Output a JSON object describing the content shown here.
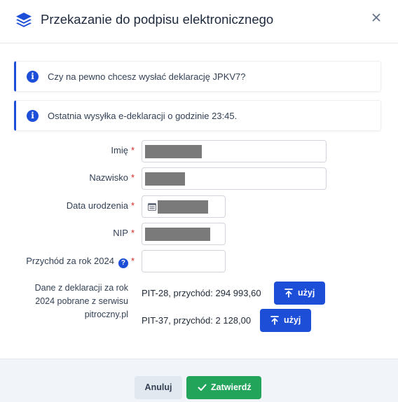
{
  "dialog": {
    "title": "Przekazanie do podpisu elektronicznego",
    "icon": "layers-icon",
    "close_icon": "close-icon"
  },
  "alerts": [
    {
      "text": "Czy na pewno chcesz wysłać deklarację JPKV7?",
      "icon": "info-icon"
    },
    {
      "text": "Ostatnia wysyłka e-deklaracji o godzinie 23:45.",
      "icon": "info-icon"
    }
  ],
  "form": {
    "required_mark": "*",
    "first_name": {
      "label": "Imię",
      "value": ""
    },
    "last_name": {
      "label": "Nazwisko",
      "value": ""
    },
    "birth_date": {
      "label": "Data urodzenia",
      "value": "",
      "icon": "calendar-icon"
    },
    "nip": {
      "label": "NIP",
      "value": ""
    },
    "income": {
      "label": "Przychód za rok 2024",
      "value": "",
      "help": "?"
    }
  },
  "declarations": {
    "source_label": "Dane z deklaracji za rok 2024 pobrane z serwisu pitroczny.pl",
    "items": [
      {
        "text": "PIT-28, przychód: 294 993,60",
        "button": "użyj"
      },
      {
        "text": "PIT-37, przychód: 2 128,00",
        "button": "użyj"
      }
    ]
  },
  "footer": {
    "cancel": "Anuluj",
    "confirm": "Zatwierdź"
  },
  "colors": {
    "primary": "#1d4ed8",
    "success": "#22a55a",
    "required": "#dc2626"
  }
}
